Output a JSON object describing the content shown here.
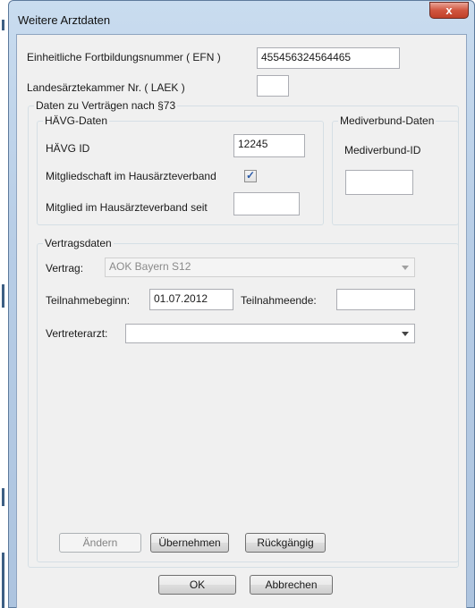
{
  "window": {
    "title": "Weitere Arztdaten",
    "close_label": "x"
  },
  "efn": {
    "label": "Einheitliche Fortbildungsnummer ( EFN )",
    "value": "455456324564465"
  },
  "laek": {
    "label": "Landesärztekammer Nr. ( LAEK )",
    "value": ""
  },
  "vertraege_group": {
    "title": "Daten zu Verträgen nach §73"
  },
  "haevg": {
    "title": "HÄVG-Daten",
    "id_label": "HÄVG ID",
    "id_value": "12245",
    "membership_label": "Mitgliedschaft im Hausärzteverband",
    "membership_checked": true,
    "check_glyph": "✓",
    "since_label": "Mitglied im Hausärzteverband seit",
    "since_value": ""
  },
  "mediverbund": {
    "title": "Mediverbund-Daten",
    "id_label": "Mediverbund-ID",
    "id_value": ""
  },
  "vertragsdaten": {
    "title": "Vertragsdaten",
    "vertrag_label": "Vertrag:",
    "vertrag_value": "AOK Bayern S12",
    "start_label": "Teilnahmebeginn:",
    "start_value": "01.07.2012",
    "end_label": "Teilnahmeende:",
    "end_value": "",
    "vertreter_label": "Vertreterarzt:",
    "vertreter_value": ""
  },
  "buttons": {
    "aendern": "Ändern",
    "uebernehmen": "Übernehmen",
    "rueckgaengig": "Rückgängig",
    "ok": "OK",
    "abbrechen": "Abbrechen"
  }
}
